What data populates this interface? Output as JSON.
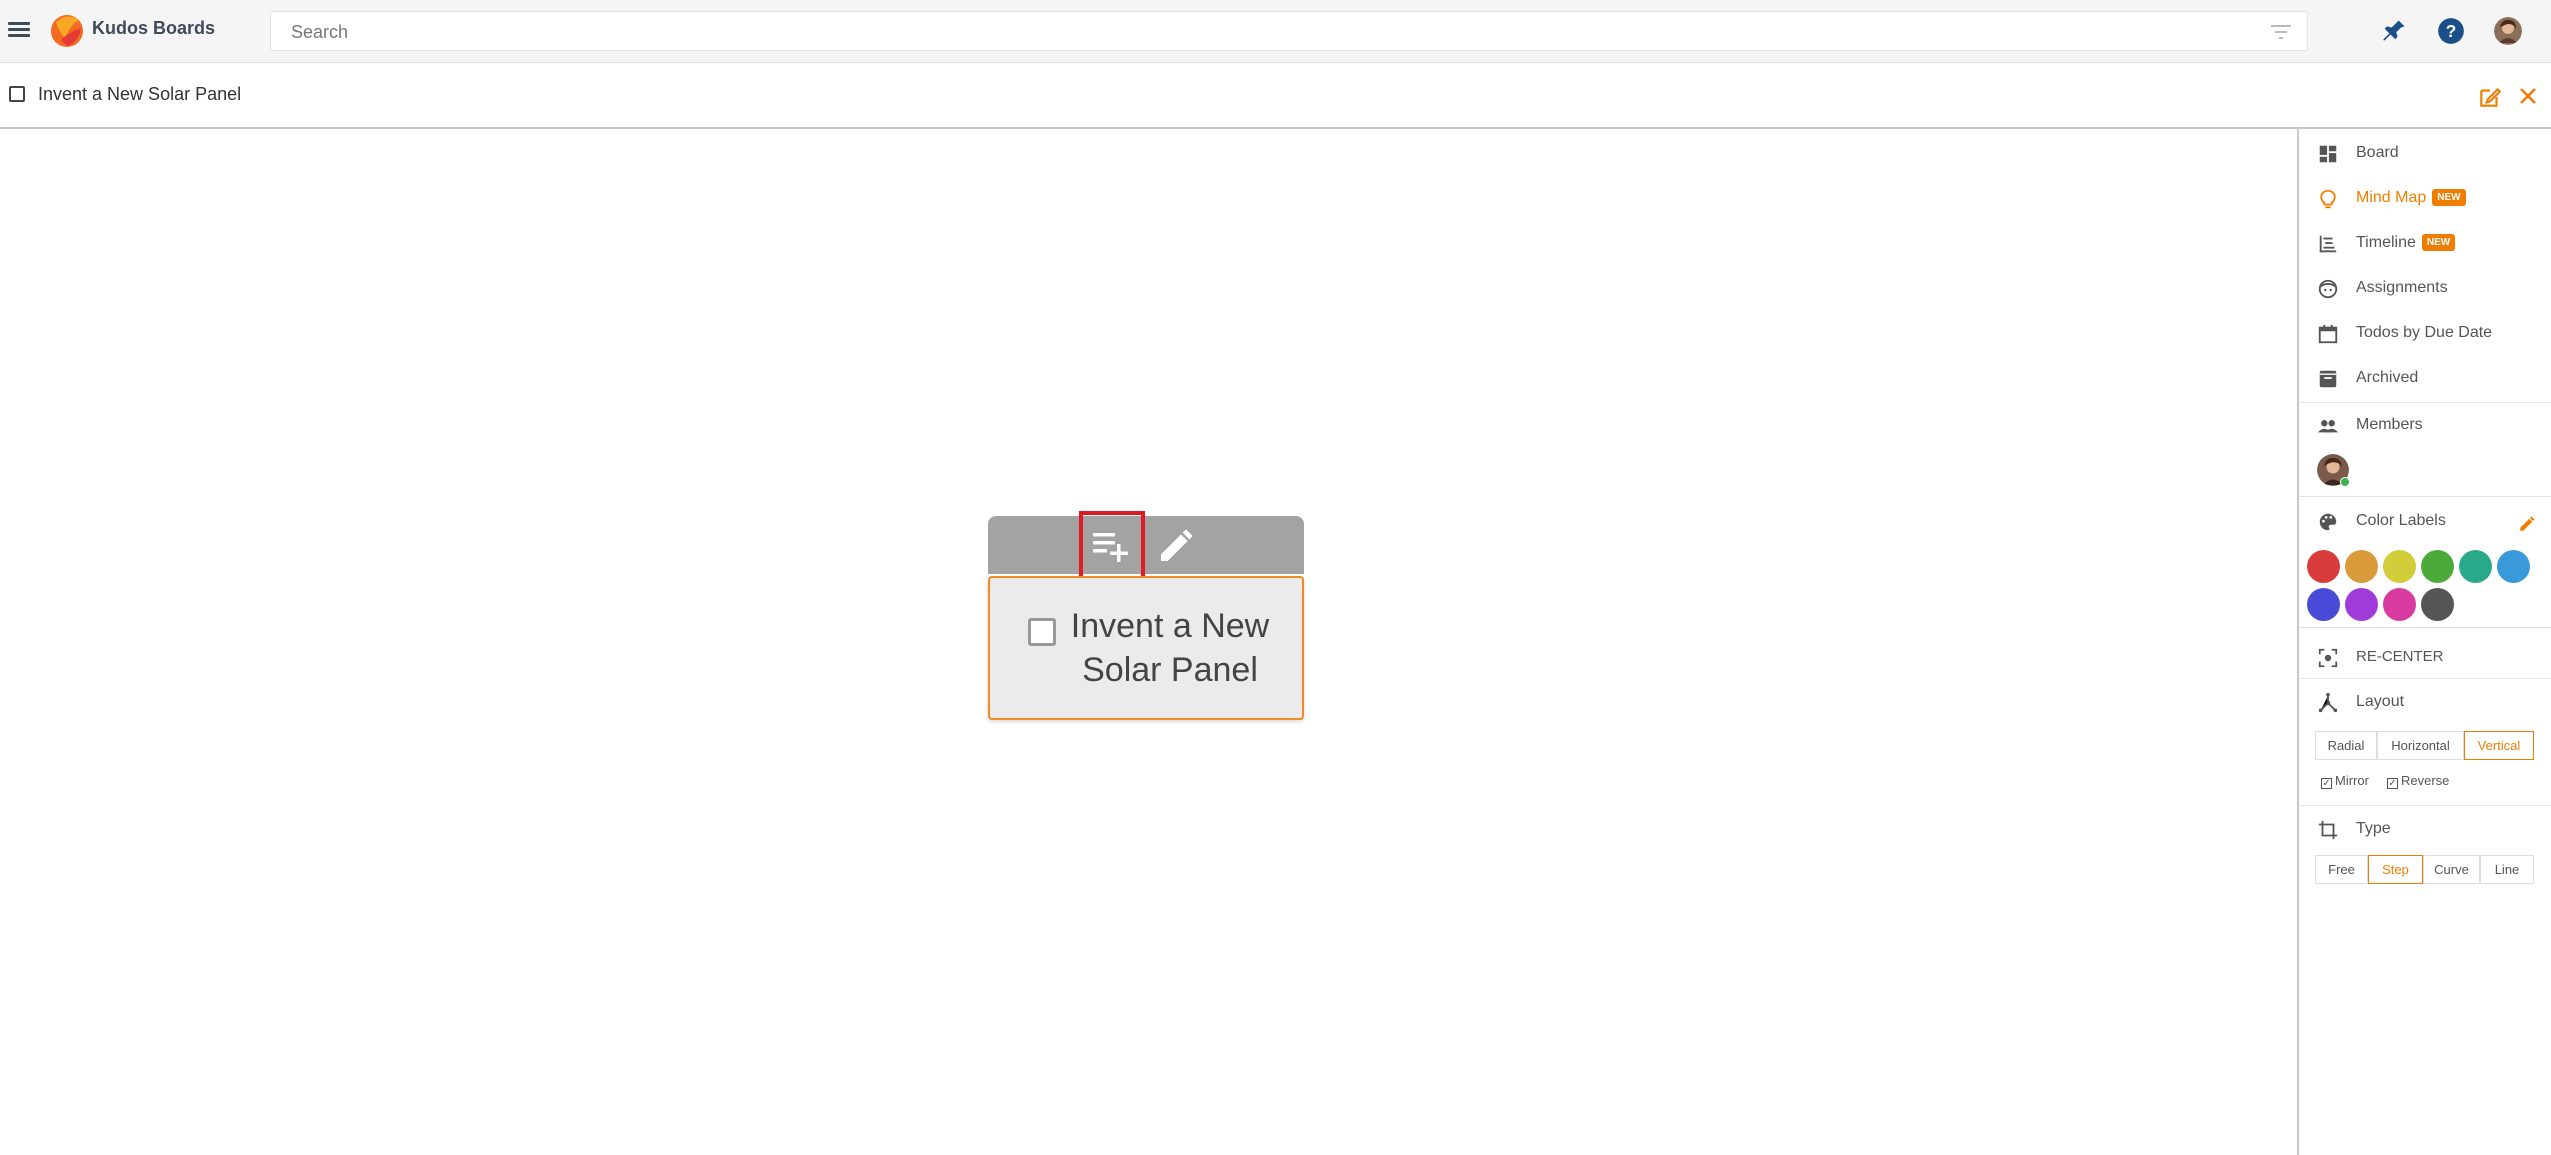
{
  "app": {
    "name": "Kudos Boards"
  },
  "search": {
    "placeholder": "Search"
  },
  "board": {
    "title": "Invent a New Solar Panel"
  },
  "node": {
    "text": "Invent a New Solar Panel"
  },
  "sidebar": {
    "views": [
      {
        "label": "Board",
        "icon": "dashboard-icon"
      },
      {
        "label": "Mind Map",
        "icon": "lightbulb-icon",
        "badge": "NEW",
        "active": true
      },
      {
        "label": "Timeline",
        "icon": "timeline-icon",
        "badge": "NEW"
      },
      {
        "label": "Assignments",
        "icon": "face-icon"
      },
      {
        "label": "Todos by Due Date",
        "icon": "calendar-icon"
      },
      {
        "label": "Archived",
        "icon": "archive-icon"
      }
    ],
    "members_label": "Members",
    "color_labels_label": "Color Labels",
    "colors": [
      "#d93a3a",
      "#d99a3a",
      "#d0cc3a",
      "#4caa3a",
      "#2aa88a",
      "#3a9ad9",
      "#4a4ad9",
      "#a03ad9",
      "#d93aa0",
      "#555555"
    ],
    "recenter_label": "RE-CENTER",
    "layout_label": "Layout",
    "layout_options": [
      "Radial",
      "Horizontal",
      "Vertical"
    ],
    "layout_selected": "Vertical",
    "mirror_label": "Mirror",
    "reverse_label": "Reverse",
    "type_label": "Type",
    "type_options": [
      "Free",
      "Step",
      "Curve",
      "Line"
    ],
    "type_selected": "Step"
  }
}
